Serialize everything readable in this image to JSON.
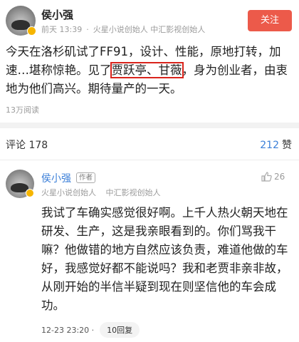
{
  "post": {
    "author": "侯小强",
    "time": "前天 13:39",
    "bio_1": "火星小说创始人",
    "bio_2": "中汇影视创始人",
    "follow_label": "关注",
    "text_before": "今天在洛杉矶试了FF91，设计、性能，原地打转，加速…堪称惊艳。见了",
    "text_highlight": "贾跃亭、甘薇",
    "text_after": "，身为创业者，由衷地为他们高兴。期待量产的一天。",
    "reads": "13万阅读"
  },
  "comment_bar": {
    "label": "评论 178",
    "likes": "212",
    "likes_label": "赞"
  },
  "comment": {
    "author": "侯小强",
    "badge": "作者",
    "bio_1": "火星小说创始人",
    "bio_2": "中汇影视创始人",
    "likes": "26",
    "text": "我试了车确实感觉很好啊。上千人热火朝天地在研发、生产，这是我亲眼看到的。你们骂我干嘛？他做错的地方自然应该负责，难道他做的车好，我感觉好都不能说吗？我和老贾非亲非故，从刚开始的半信半疑到现在则坚信他的车会成功。",
    "time": "12-23 23:20 ·",
    "reply_label": "10回复"
  },
  "colors": {
    "accent_red": "#ec5a4a",
    "highlight_box": "#d9231b",
    "link_blue": "#3b7fd8",
    "verified": "#f6b500"
  },
  "icons": {
    "verified": "verified-badge-icon",
    "like": "thumbs-up-icon"
  }
}
